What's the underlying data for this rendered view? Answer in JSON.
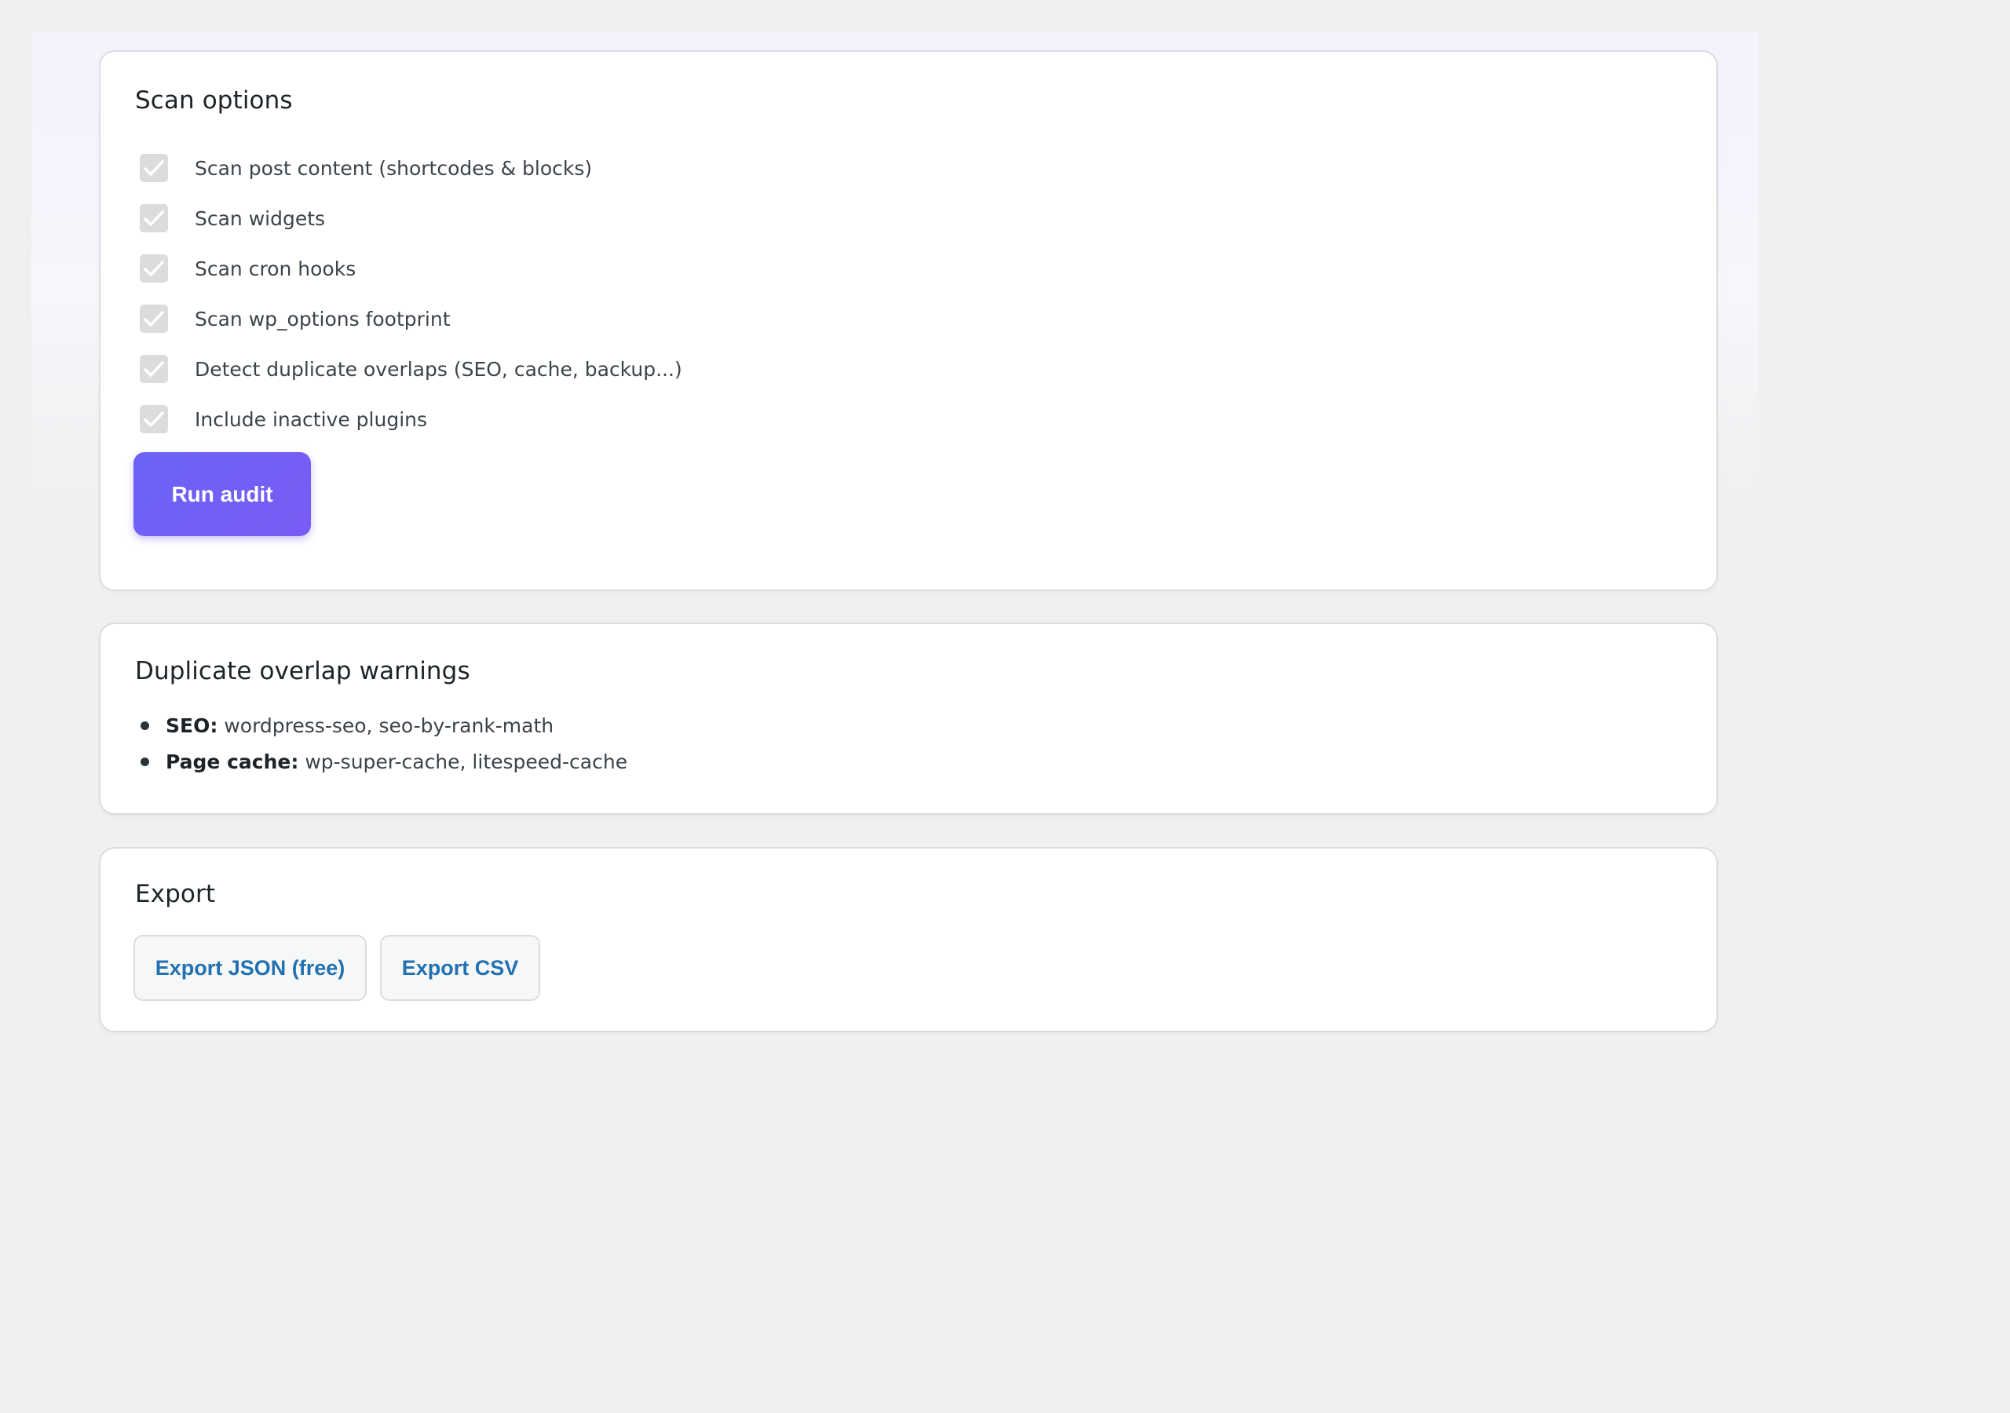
{
  "scan_options": {
    "title": "Scan options",
    "options": [
      {
        "label": "Scan post content (shortcodes & blocks)",
        "checked": true
      },
      {
        "label": "Scan widgets",
        "checked": true
      },
      {
        "label": "Scan cron hooks",
        "checked": true
      },
      {
        "label": "Scan wp_options footprint",
        "checked": true
      },
      {
        "label": "Detect duplicate overlaps (SEO, cache, backup...)",
        "checked": true
      },
      {
        "label": "Include inactive plugins",
        "checked": true
      }
    ],
    "run_label": "Run audit"
  },
  "duplicates": {
    "title": "Duplicate overlap warnings",
    "items": [
      {
        "key": "SEO:",
        "value": "wordpress-seo, seo-by-rank-math"
      },
      {
        "key": "Page cache:",
        "value": "wp-super-cache, litespeed-cache"
      }
    ]
  },
  "export": {
    "title": "Export",
    "json_label": "Export JSON (free)",
    "csv_label": "Export CSV"
  },
  "colors": {
    "page_bg": "#f0f0f1",
    "accent": "#6c63f6",
    "link": "#2271b1",
    "checkbox_disabled": "#dcdcde"
  }
}
